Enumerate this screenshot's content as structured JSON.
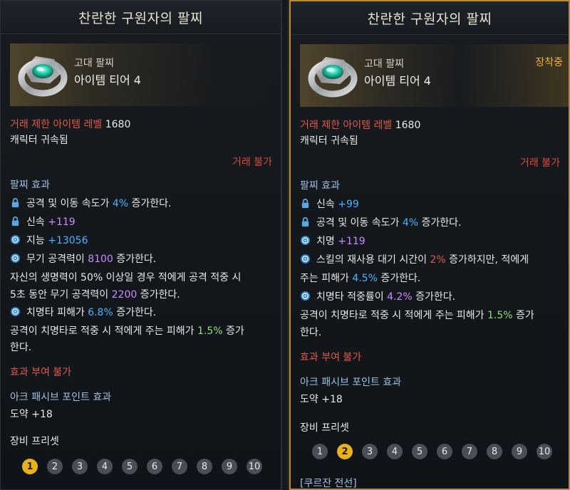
{
  "left": {
    "title": "찬란한 구원자의 팔찌",
    "item_type": "고대 팔찌",
    "item_tier": "아이템 티어 4",
    "trade_level_label": "거래 제한 아이템 레벨",
    "trade_level_value": "1680",
    "bound": "캐릭터 귀속됨",
    "trade": "거래 불가",
    "effects_title": "팔찌 효과",
    "effects": [
      {
        "icon": "lock-icon",
        "parts": [
          "공격 및 이동 속도가 ",
          "4%",
          " 증가한다."
        ]
      },
      {
        "icon": "lock-icon",
        "parts": [
          "신속 ",
          "+119"
        ]
      },
      {
        "icon": "swirl-icon",
        "parts": [
          "지능 ",
          "+13056"
        ]
      },
      {
        "icon": "swirl-icon",
        "parts": [
          "무기 공격력이 ",
          "8100",
          " 증가한다."
        ]
      }
    ],
    "cond_text_1": "자신의 생명력이 50% 이상일 경우 적에게 공격 적중 시",
    "cond_text_2a": "5초 동안 무기 공격력이 ",
    "cond_text_2b": "2200",
    "cond_text_2c": " 증가한다.",
    "crit_parts": [
      "치명타 피해가 ",
      "6.8%",
      " 증가한다."
    ],
    "crit2_a": "공격이 치명타로 적중 시 적에게 주는 피해가 ",
    "crit2_b": "1.5%",
    "crit2_c": " 증가",
    "crit2_d": "한다.",
    "no_effect": "효과 부여 불가",
    "ark_title": "아크 패시브 포인트 효과",
    "ark_value": "도약 +18",
    "preset_title": "장비 프리셋",
    "presets": [
      "1",
      "2",
      "3",
      "4",
      "5",
      "6",
      "7",
      "8",
      "9",
      "10"
    ],
    "active_preset": "1"
  },
  "right": {
    "title": "찬란한 구원자의 팔찌",
    "item_type": "고대 팔찌",
    "item_tier": "아이템 티어 4",
    "equipped": "장착중",
    "trade_level_label": "거래 제한 아이템 레벨",
    "trade_level_value": "1680",
    "bound": "캐릭터 귀속됨",
    "trade": "거래 불가",
    "effects_title": "팔찌 효과",
    "effects": [
      {
        "icon": "lock-icon",
        "parts": [
          "신속 ",
          "+99"
        ]
      },
      {
        "icon": "lock-icon",
        "parts": [
          "공격 및 이동 속도가 ",
          "4%",
          " 증가한다."
        ]
      },
      {
        "icon": "swirl-icon",
        "parts": [
          "치명 ",
          "+119"
        ]
      }
    ],
    "cool_a": "스킬의 재사용 대기 시간이 ",
    "cool_b": "2%",
    "cool_c": " 증가하지만, 적에게",
    "cool_d": "주는 피해가 ",
    "cool_e": "4.5%",
    "cool_f": " 증가한다.",
    "critrate_parts": [
      "치명타 적중률이 ",
      "4.2%",
      " 증가한다."
    ],
    "crit2_a": "공격이 치명타로 적중 시 적에게 주는 피해가 ",
    "crit2_b": "1.5%",
    "crit2_c": " 증가",
    "crit2_d": "한다.",
    "no_effect": "효과 부여 불가",
    "ark_title": "아크 패시브 포인트 효과",
    "ark_value": "도약 +18",
    "preset_title": "장비 프리셋",
    "presets": [
      "1",
      "2",
      "3",
      "4",
      "5",
      "6",
      "7",
      "8",
      "9",
      "10"
    ],
    "active_preset": "2",
    "footer_link": "[쿠르잔 전선]"
  },
  "colors": {
    "accent_gold": "#e7b21c",
    "red": "#e05a4a",
    "blue": "#49b4ff",
    "purple": "#c98bff",
    "green": "#8ee07a",
    "section": "#9ec2e0"
  }
}
